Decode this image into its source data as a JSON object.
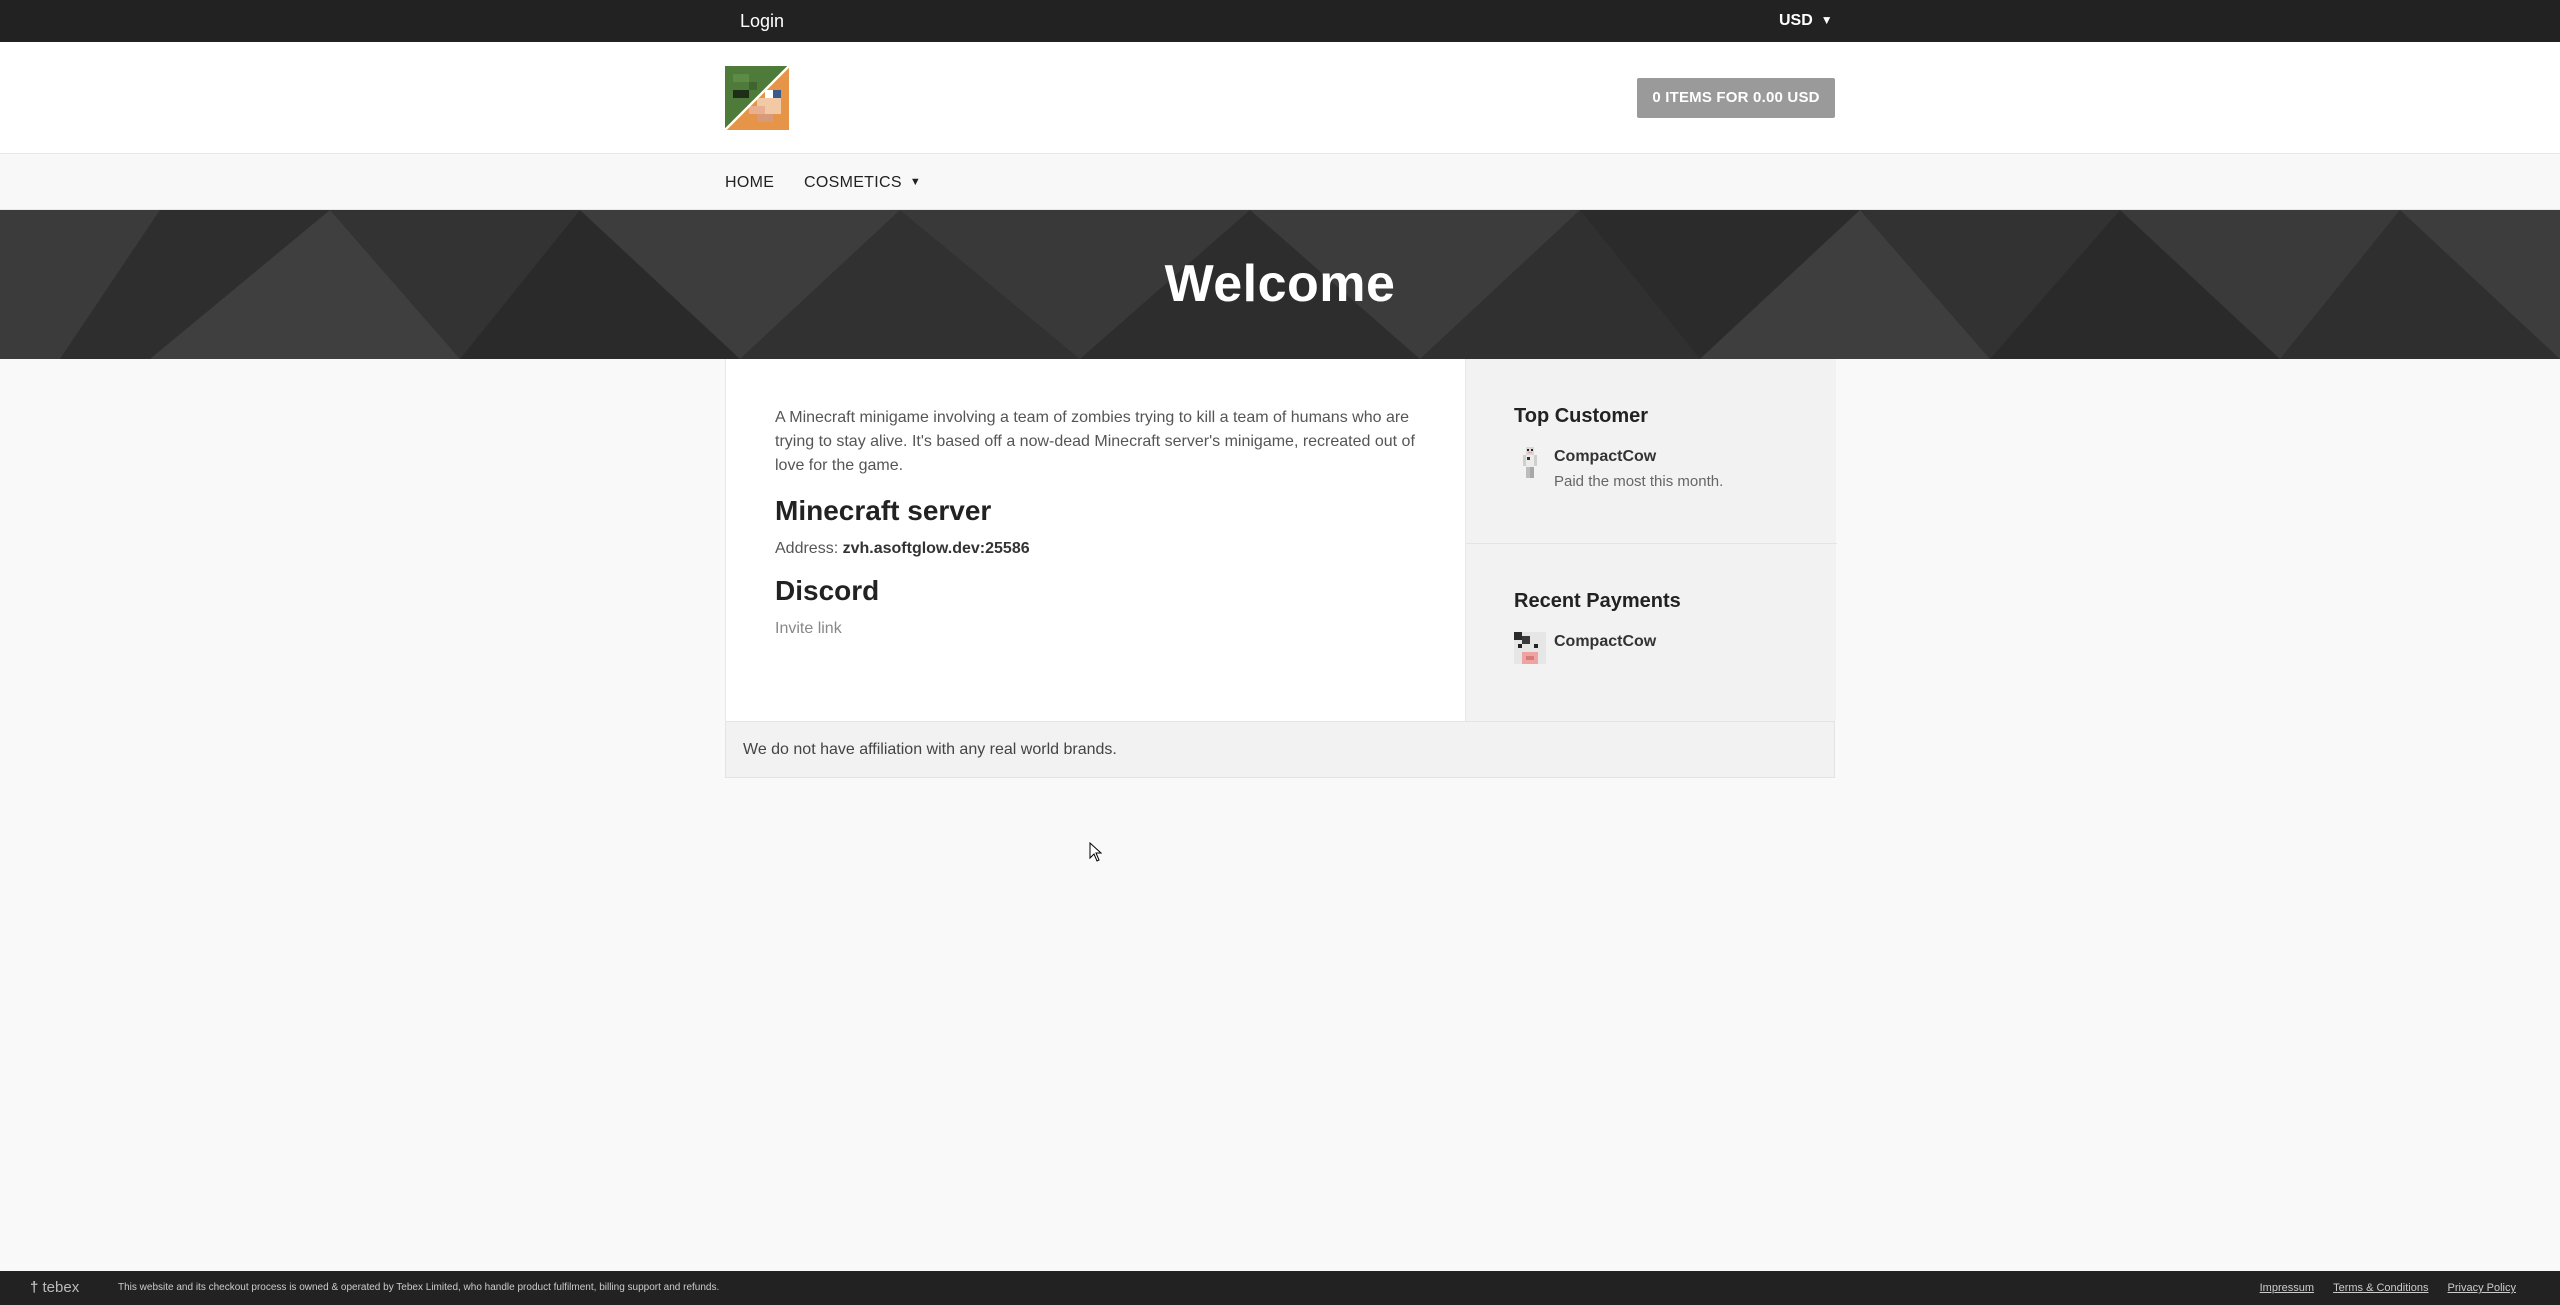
{
  "topbar": {
    "login_label": "Login",
    "currency_label": "USD"
  },
  "header": {
    "basket_label": "0 ITEMS FOR 0.00 USD"
  },
  "nav": {
    "items": [
      {
        "label": "HOME"
      },
      {
        "label": "COSMETICS"
      }
    ]
  },
  "banner": {
    "title": "Welcome"
  },
  "content": {
    "description": "A Minecraft minigame involving a team of zombies trying to kill a team of humans who are trying to stay alive. It's based off a now-dead Minecraft server's minigame, recreated out of love for the game.",
    "server_heading": "Minecraft server",
    "address_label": "Address:",
    "address_value": "zvh.asoftglow.dev:25586",
    "discord_heading": "Discord",
    "invite_label": "Invite link"
  },
  "sidebar": {
    "top_customer": {
      "title": "Top Customer",
      "name": "CompactCow",
      "subtitle": "Paid the most this month."
    },
    "recent_payments": {
      "title": "Recent Payments",
      "name": "CompactCow"
    }
  },
  "affiliation_notice": "We do not have affiliation with any real world brands.",
  "footer": {
    "brand": "tebex",
    "notice": "This website and its checkout process is owned & operated by Tebex Limited, who handle product fulfilment, billing support and refunds.",
    "links": [
      "Impressum",
      "Terms & Conditions",
      "Privacy Policy"
    ]
  }
}
